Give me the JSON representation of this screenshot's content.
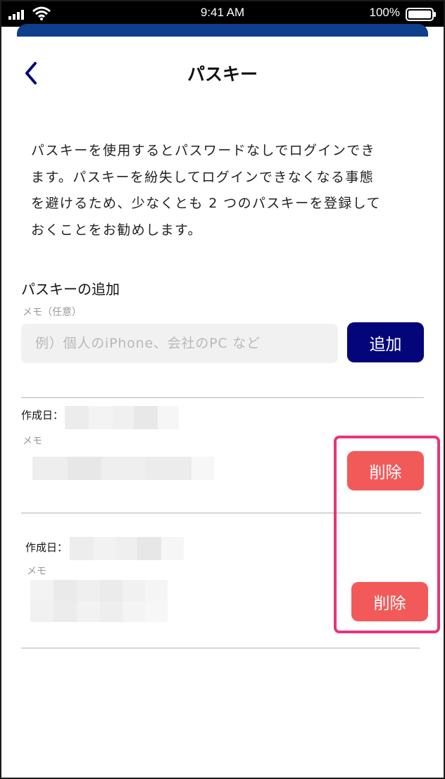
{
  "status_bar": {
    "time": "9:41 AM",
    "battery_percent": "100%",
    "battery_level": 1.0,
    "icons": [
      "signal-icon",
      "wifi-icon",
      "battery-icon"
    ]
  },
  "header": {
    "title": "パスキー",
    "back_icon": "chevron-left-icon"
  },
  "description": {
    "lines": [
      "パスキーを使用するとパスワードなしでログインでき",
      "ます。パスキーを紛失してログインできなくなる事態",
      "を避けるため、少なくとも 2 つのパスキーを登録して",
      "おくことをお勧めします。"
    ]
  },
  "add_section": {
    "title": "パスキーの追加",
    "memo_label": "メモ（任意）",
    "memo_placeholder": "例）個人のiPhone、会社のPC など",
    "add_button_label": "追加"
  },
  "passkeys": [
    {
      "date_label": "作成日：",
      "memo_label": "メモ",
      "delete_label": "削除"
    },
    {
      "date_label": "作成日：",
      "memo_label": "メモ",
      "delete_label": "削除"
    }
  ],
  "colors": {
    "primary": "#05057a",
    "delete": "#f25a5a",
    "highlight": "#ea3377",
    "input_bg": "#f1f1f1"
  }
}
